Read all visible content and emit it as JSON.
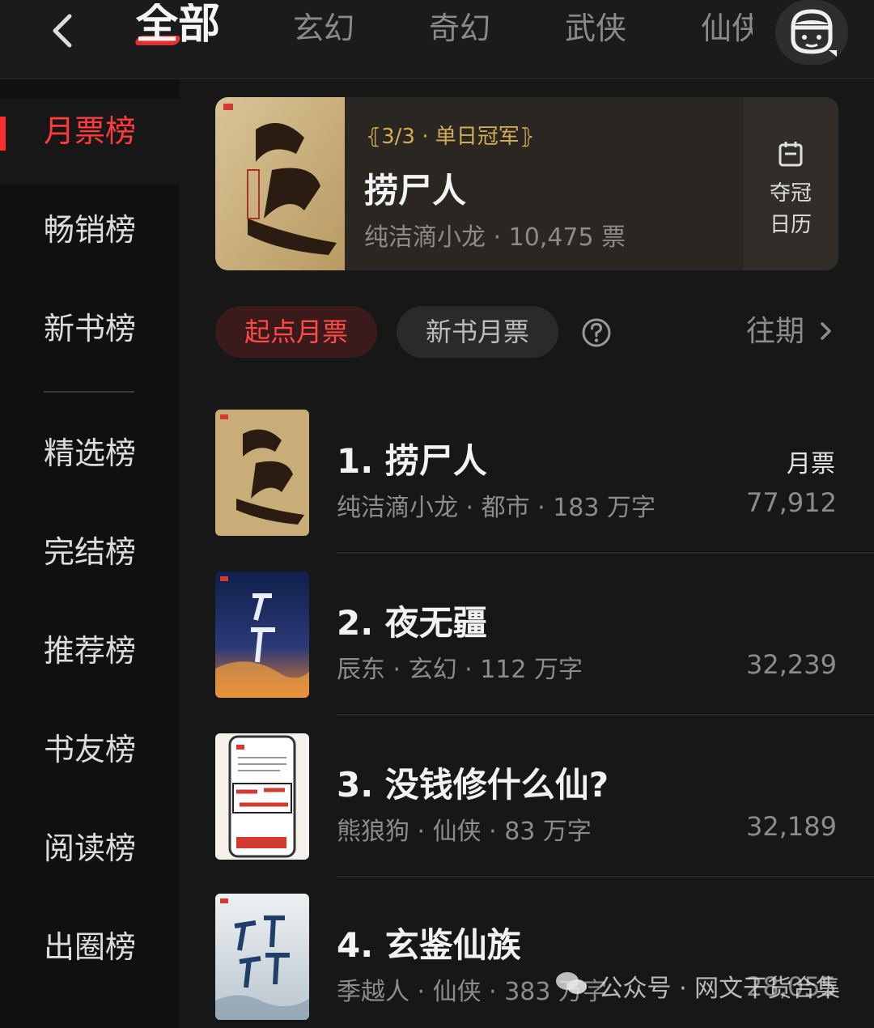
{
  "header": {
    "tabs": [
      {
        "label": "全部",
        "active": true
      },
      {
        "label": "玄幻",
        "active": false
      },
      {
        "label": "奇幻",
        "active": false
      },
      {
        "label": "武侠",
        "active": false
      },
      {
        "label": "仙侠",
        "active": false
      }
    ],
    "accent_color": "#e2322f"
  },
  "sidebar": {
    "items": [
      {
        "label": "月票榜",
        "active": true
      },
      {
        "label": "畅销榜",
        "active": false
      },
      {
        "label": "新书榜",
        "active": false
      },
      {
        "label": "精选榜",
        "active": false
      },
      {
        "label": "完结榜",
        "active": false
      },
      {
        "label": "推荐榜",
        "active": false
      },
      {
        "label": "书友榜",
        "active": false
      },
      {
        "label": "阅读榜",
        "active": false
      },
      {
        "label": "出圈榜",
        "active": false
      }
    ]
  },
  "champion": {
    "badge": "3/3 · 单日冠军",
    "title": "捞尸人",
    "meta": "纯洁滴小龙 · 10,475 票",
    "calendar_label_1": "夺冠",
    "calendar_label_2": "日历",
    "badge_color": "#d4ad55"
  },
  "filters": {
    "active": "起点月票",
    "other": "新书月票",
    "history": "往期"
  },
  "ranking": {
    "votes_label": "月票",
    "items": [
      {
        "title": "1. 捞尸人",
        "meta": "纯洁滴小龙 · 都市 · 183 万字",
        "votes": "77,912"
      },
      {
        "title": "2. 夜无疆",
        "meta": "辰东 · 玄幻 · 112 万字",
        "votes": "32,239"
      },
      {
        "title": "3. 没钱修什么仙?",
        "meta": "熊狼狗 · 仙侠 · 83 万字",
        "votes": "32,189"
      },
      {
        "title": "4. 玄鉴仙族",
        "meta": "季越人 · 仙侠 · 383 万字",
        "votes": "28,055"
      }
    ]
  },
  "watermark": {
    "text": "公众号 · 网文干货合集"
  }
}
